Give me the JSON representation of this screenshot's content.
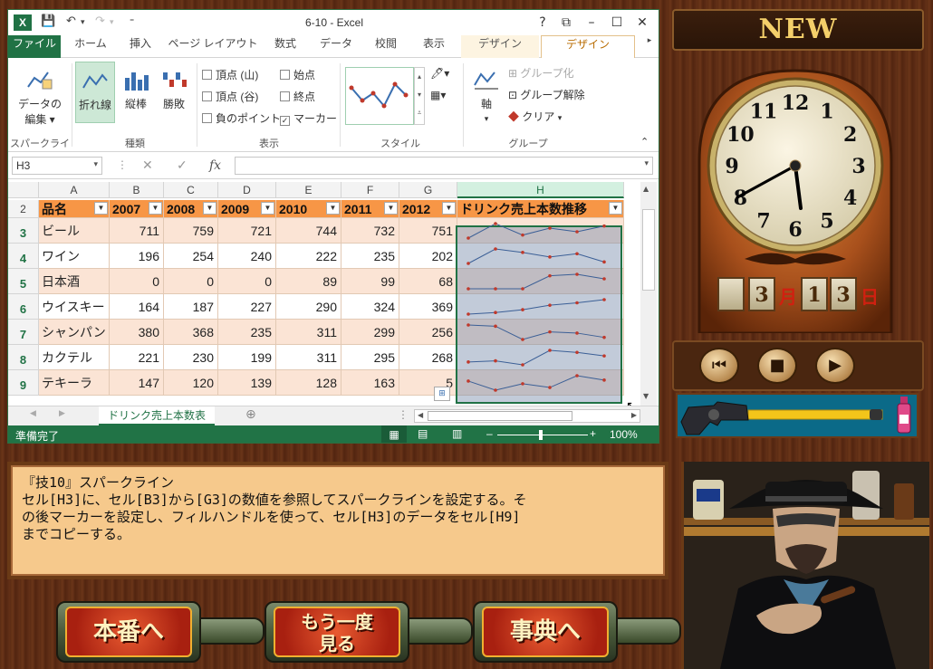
{
  "excel": {
    "window_title": "6-10 - Excel",
    "tabs": [
      "ファイル",
      "ホーム",
      "挿入",
      "ページ レイアウト",
      "数式",
      "データ",
      "校閲",
      "表示",
      "デザイン",
      "デザイン"
    ],
    "ribbon": {
      "sparkline": {
        "edit_data": "データの\n編集",
        "edit_data_l1": "データの",
        "edit_data_l2": "編集 ▾",
        "group": "スパークライン"
      },
      "type": {
        "line": "折れ線",
        "column": "縦棒",
        "winloss": "勝敗",
        "group": "種類"
      },
      "show": {
        "high": "頂点 (山)",
        "low": "頂点 (谷)",
        "negative": "負のポイント",
        "first": "始点",
        "last": "終点",
        "marker": "マーカー",
        "group": "表示"
      },
      "style": {
        "group": "スタイル"
      },
      "group": {
        "axis": "軸",
        "group_btn": "グループ化",
        "ungroup": "グループ解除",
        "clear": "クリア",
        "group": "グループ"
      }
    },
    "namebox": "H3",
    "fx_symbol": "fx",
    "columns": [
      "A",
      "B",
      "C",
      "D",
      "E",
      "F",
      "G",
      "H"
    ],
    "header_row": {
      "row": "2",
      "cells": [
        "品名",
        "2007",
        "2008",
        "2009",
        "2010",
        "2011",
        "2012",
        "ドリンク売上本数推移"
      ]
    },
    "rows": [
      {
        "row": "3",
        "name": "ビール",
        "values": [
          711,
          759,
          721,
          744,
          732,
          751
        ]
      },
      {
        "row": "4",
        "name": "ワイン",
        "values": [
          196,
          254,
          240,
          222,
          235,
          202
        ]
      },
      {
        "row": "5",
        "name": "日本酒",
        "values": [
          0,
          0,
          0,
          89,
          99,
          68
        ]
      },
      {
        "row": "6",
        "name": "ウイスキー",
        "values": [
          164,
          187,
          227,
          290,
          324,
          369
        ]
      },
      {
        "row": "7",
        "name": "シャンパン",
        "values": [
          380,
          368,
          235,
          311,
          299,
          256
        ]
      },
      {
        "row": "8",
        "name": "カクテル",
        "values": [
          221,
          230,
          199,
          311,
          295,
          268
        ]
      },
      {
        "row": "9",
        "name": "テキーラ",
        "values": [
          147,
          120,
          139,
          128,
          163,
          "5"
        ]
      }
    ],
    "sheet_tab": "ドリンク売上本数表",
    "status": "準備完了",
    "zoom": "100%"
  },
  "right": {
    "new_sign": "NEW",
    "clock_numbers": [
      "12",
      "1",
      "2",
      "3",
      "4",
      "5",
      "6",
      "7",
      "8",
      "9",
      "10",
      "11"
    ],
    "date": {
      "month": "3",
      "month_label": "月",
      "day_1": "1",
      "day_2": "3",
      "day_label": "日"
    },
    "controls": {
      "prev": "⏮",
      "stop": "■",
      "play": "▶"
    }
  },
  "message": {
    "line1": "『技10』スパークライン",
    "line2": "セル[H3]に、セル[B3]から[G3]の数値を参照してスパークラインを設定する。そ",
    "line3": "の後マーカーを設定し、フィルハンドルを使って、セル[H3]のデータをセル[H9]",
    "line4": "までコピーする。"
  },
  "buttons": {
    "production": "本番へ",
    "retry_l1": "もう一度",
    "retry_l2": "見る",
    "dictionary": "事典へ"
  },
  "colors": {
    "excel_green": "#217346",
    "header_orange": "#f79646",
    "band_peach": "#fbe4d5",
    "message_bg": "#f6c98c"
  }
}
